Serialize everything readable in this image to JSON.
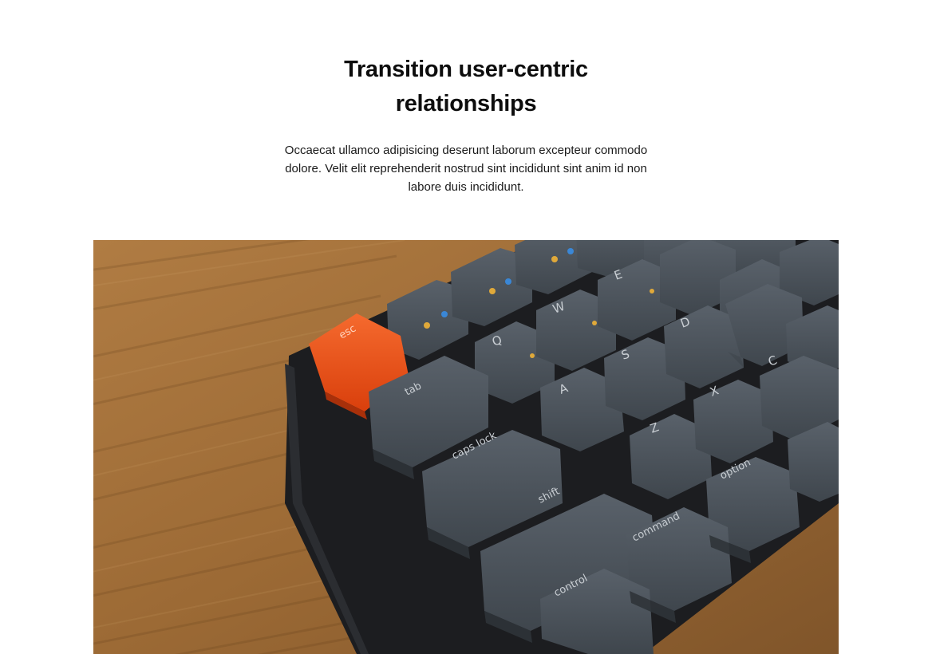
{
  "hero": {
    "title": "Transition user-centric relationships",
    "lead": "Occaecat ullamco adipisicing deserunt laborum excepteur commodo dolore. Velit elit reprehenderit nostrud sint incididunt sint anim id non labore duis incididunt."
  },
  "photo": {
    "keys": {
      "esc": "esc",
      "tab": "tab",
      "caps": "caps lock",
      "shift": "shift",
      "command": "command",
      "control": "control",
      "option": "option",
      "q": "Q",
      "w": "W",
      "e": "E",
      "a": "A",
      "s": "S",
      "d": "D",
      "z": "Z",
      "x": "X",
      "c": "C"
    },
    "colors": {
      "wood": "#a5753f",
      "key": "#4a525a",
      "esc_key": "#f0521c",
      "frame": "#1c1d20"
    }
  }
}
